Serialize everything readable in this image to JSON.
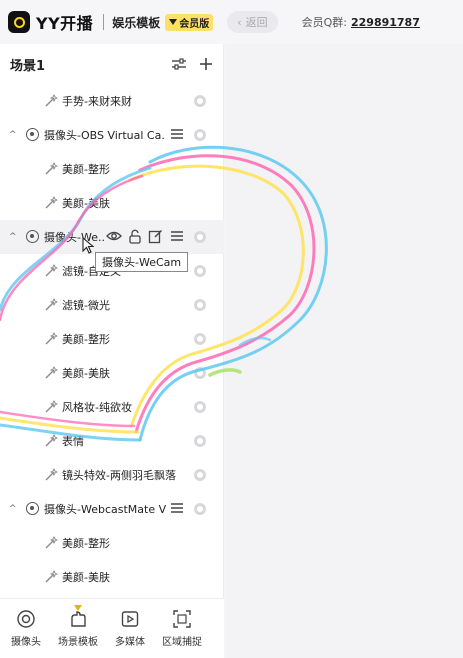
{
  "header": {
    "brand": "YY开播",
    "mode": "娱乐模板",
    "vip_badge": "会员版",
    "back_label": "返回",
    "qq_label": "会员Q群:",
    "qq_number": "229891787"
  },
  "scene": {
    "title": "场景1"
  },
  "rows": [
    {
      "type": "effect",
      "label": "手势-来财来财"
    },
    {
      "type": "camera",
      "label": "摄像头-OBS Virtual Ca..."
    },
    {
      "type": "effect",
      "label": "美颜-整形"
    },
    {
      "type": "effect",
      "label": "美颜-美肤"
    },
    {
      "type": "camera",
      "label": "摄像头-We..."
    },
    {
      "type": "effect",
      "label": "滤镜-自定义"
    },
    {
      "type": "effect",
      "label": "滤镜-微光"
    },
    {
      "type": "effect",
      "label": "美颜-整形"
    },
    {
      "type": "effect",
      "label": "美颜-美肤"
    },
    {
      "type": "effect",
      "label": "风格妆-纯欲妆"
    },
    {
      "type": "effect",
      "label": "表情"
    },
    {
      "type": "effect",
      "label": "镜头特效-两侧羽毛飘落"
    },
    {
      "type": "camera",
      "label": "摄像头-WebcastMate Vi..."
    },
    {
      "type": "effect",
      "label": "美颜-整形"
    },
    {
      "type": "effect",
      "label": "美颜-美肤"
    }
  ],
  "tooltip": "摄像头-WeCam",
  "bottom_nav": [
    {
      "label": "摄像头",
      "icon": "camera-icon"
    },
    {
      "label": "场景模板",
      "icon": "template-icon"
    },
    {
      "label": "多媒体",
      "icon": "media-icon"
    },
    {
      "label": "区域捕捉",
      "icon": "capture-icon"
    }
  ],
  "colors": {
    "accent": "#ffd21f",
    "heart_pink": "#ff5fae",
    "heart_blue": "#5ec8f2",
    "heart_yellow": "#ffe14d",
    "heart_green": "#a8e06a"
  }
}
